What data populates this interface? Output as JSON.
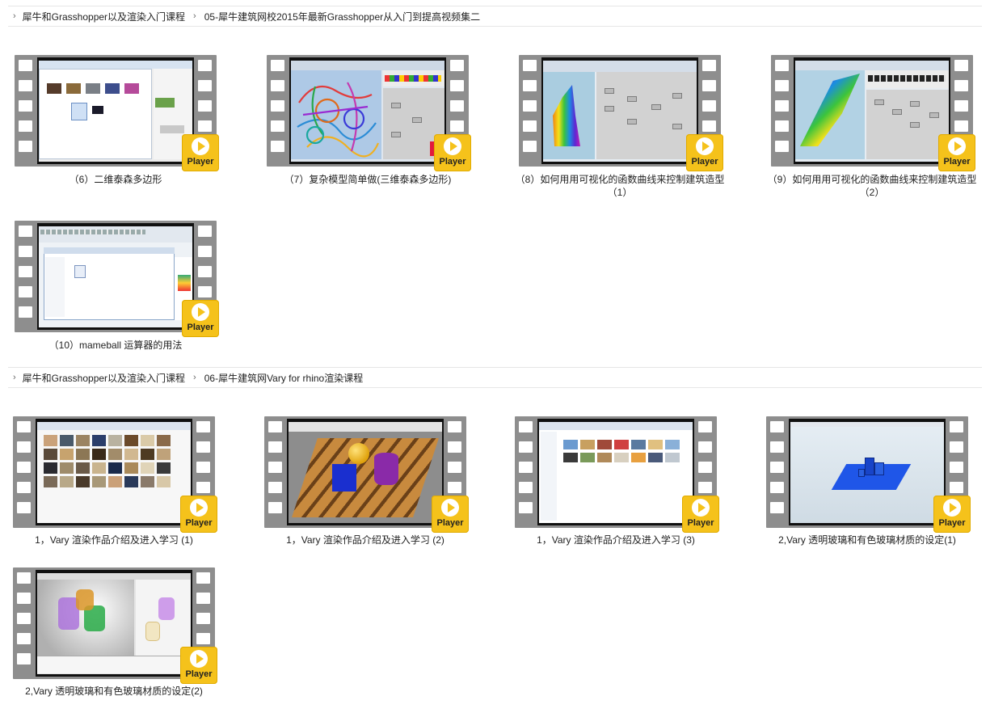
{
  "sections": [
    {
      "breadcrumb": [
        "犀牛和Grasshopper以及渲染入门课程",
        "05-犀牛建筑网校2015年最新Grasshopper从入门到提高视频集二"
      ],
      "videos": [
        {
          "caption": "（6）二维泰森多边形",
          "player": "Player"
        },
        {
          "caption": "（7）复杂模型简单做(三维泰森多边形)",
          "player": "Player"
        },
        {
          "caption": "（8）如何用用可视化的函数曲线来控制建筑造型（1）",
          "player": "Player"
        },
        {
          "caption": "（9）如何用用可视化的函数曲线来控制建筑造型（2）",
          "player": "Player"
        },
        {
          "caption": "（10）mameball 运算器的用法",
          "player": "Player"
        }
      ]
    },
    {
      "breadcrumb": [
        "犀牛和Grasshopper以及渲染入门课程",
        "06-犀牛建筑网Vary for rhino渲染课程"
      ],
      "videos": [
        {
          "caption": "1，Vary 渲染作品介绍及进入学习 (1)",
          "player": "Player"
        },
        {
          "caption": "1，Vary 渲染作品介绍及进入学习 (2)",
          "player": "Player"
        },
        {
          "caption": "1，Vary 渲染作品介绍及进入学习 (3)",
          "player": "Player"
        },
        {
          "caption": "2,Vary 透明玻璃和有色玻璃材质的设定(1)",
          "player": "Player"
        },
        {
          "caption": "2,Vary 透明玻璃和有色玻璃材质的设定(2)",
          "player": "Player"
        }
      ]
    }
  ],
  "colors": {
    "player_badge": "#f5c21b",
    "film_strip": "#8e8e8e",
    "divider": "#e6e6e6"
  },
  "icons": {
    "breadcrumb": "chevron-right-icon",
    "player": "play-circle-icon"
  }
}
